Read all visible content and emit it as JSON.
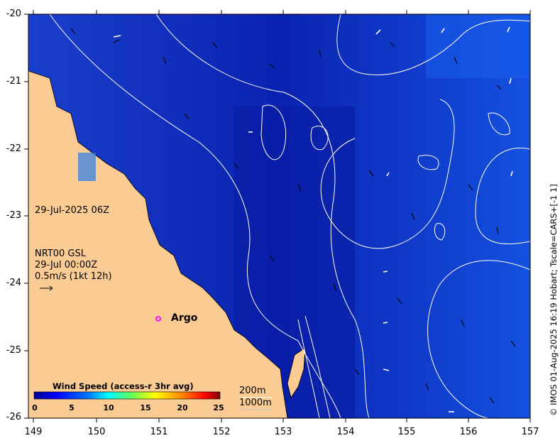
{
  "map": {
    "title_datetime": "29-Jul-2025 06Z",
    "product_lines": [
      "NRT00 GSL",
      "29-Jul 00:00Z",
      "0.5m/s (1kt 12h)"
    ],
    "credit": "© IMOS 01-Aug-2025 16:19 Hobart; Tscale=CARS+[-1 1]",
    "y_ticks": [
      "-20",
      "-21",
      "-22",
      "-23",
      "-24",
      "-25",
      "-26"
    ],
    "x_ticks": [
      "149",
      "150",
      "151",
      "152",
      "153",
      "154",
      "155",
      "156",
      "157"
    ],
    "lat_range": [
      -26,
      -20
    ],
    "lon_range": [
      149,
      157
    ],
    "argo": {
      "label": "Argo",
      "lon": 150.98,
      "lat": -24.52,
      "color": "#ff00ff"
    },
    "isobaths": [
      "200m",
      "1000m"
    ],
    "colors": {
      "land": "#fbcb94",
      "ocean_dark": "#0a1fa8",
      "ocean_mid": "#1438c8",
      "contour": "#ffffff"
    }
  },
  "colorbar": {
    "title": "Wind Speed (access-r 3hr avg)",
    "ticks": [
      "0",
      "5",
      "10",
      "15",
      "20",
      "25"
    ],
    "range": [
      0,
      25
    ],
    "colormap": [
      "#00008f",
      "#0000ff",
      "#0080ff",
      "#00ffff",
      "#80ff80",
      "#ffff00",
      "#ff8000",
      "#ff0000",
      "#800000"
    ]
  }
}
